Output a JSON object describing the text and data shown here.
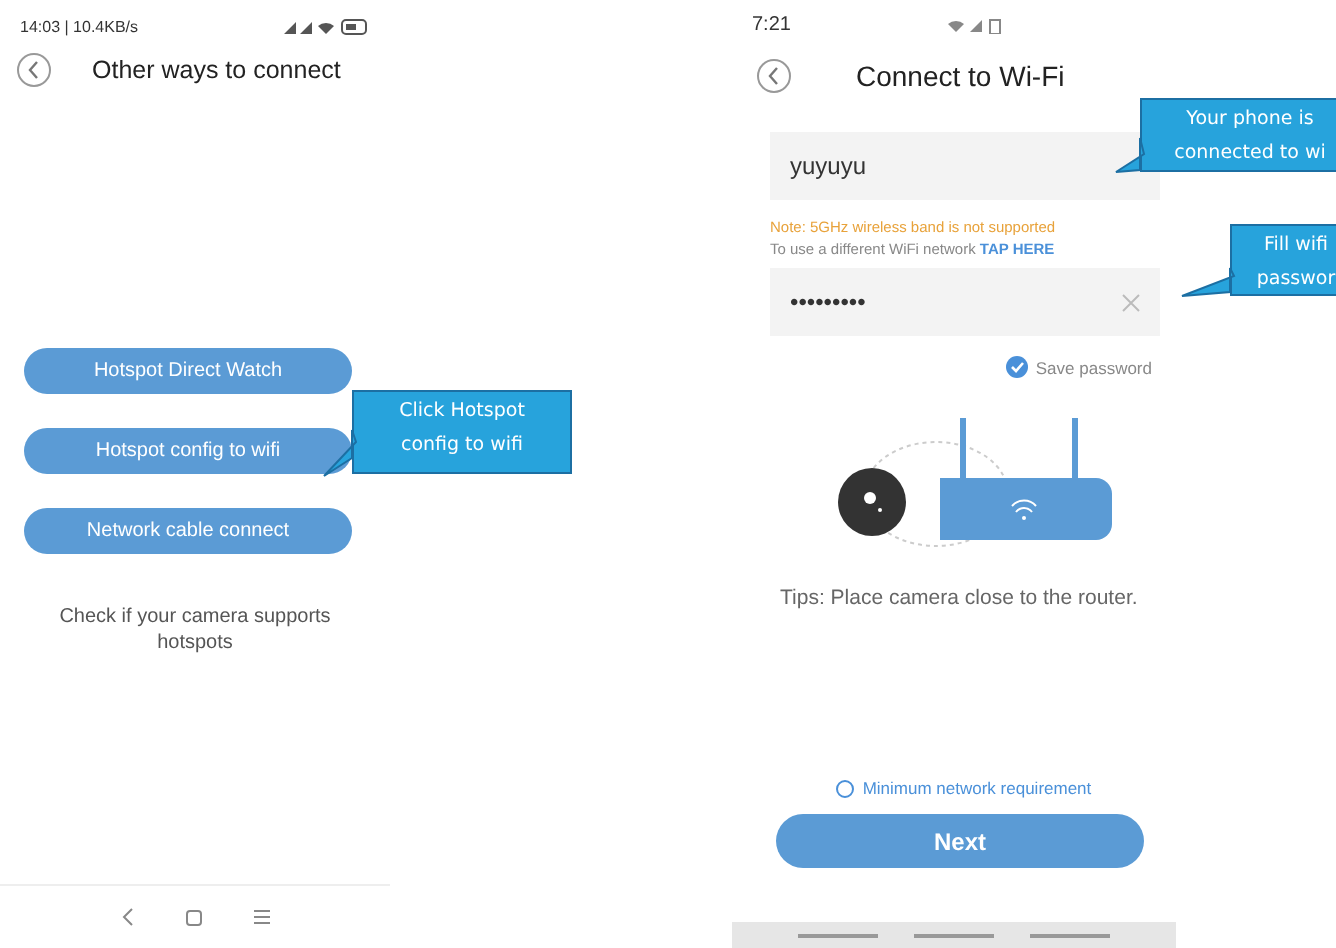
{
  "left_screen": {
    "status_bar": {
      "time": "14:03 | 10.4KB/s"
    },
    "header": {
      "title": "Other ways to connect"
    },
    "buttons": [
      "Hotspot Direct Watch",
      "Hotspot config to wifi",
      "Network cable connect"
    ],
    "hint": "Check if your camera supports hotspots"
  },
  "right_screen": {
    "status_bar": {
      "time": "7:21"
    },
    "header": {
      "title": "Connect to Wi-Fi"
    },
    "wifi_field": {
      "value": "yuyuyu"
    },
    "note": {
      "warning": "Note: 5GHz wireless band is not supported",
      "text": "To use a different WiFi network",
      "link": "TAP HERE"
    },
    "password_field": {
      "value": "•••••••••"
    },
    "save_password": {
      "label": "Save password",
      "checked": true
    },
    "tips": "Tips: Place camera close to the router.",
    "help_link": "Minimum network requirement",
    "next_button": "Next"
  },
  "callouts": [
    {
      "lines": [
        "Click Hotspot",
        "config to wifi"
      ]
    },
    {
      "lines": [
        "Your phone is",
        "connected to wi"
      ]
    },
    {
      "lines": [
        "Fill wifi",
        "passwor"
      ]
    }
  ]
}
